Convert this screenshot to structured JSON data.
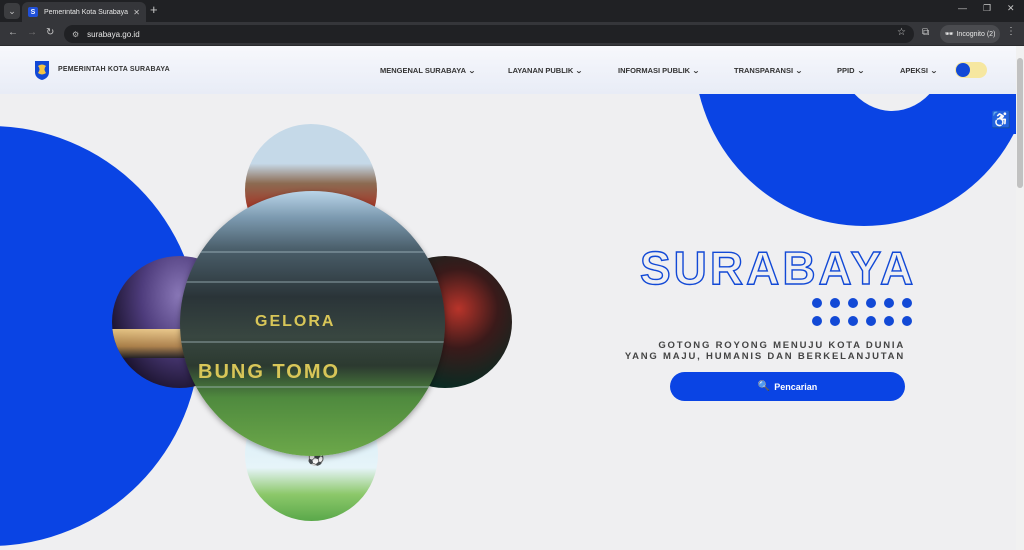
{
  "browser": {
    "tab_title": "Pemerintah Kota Surabaya",
    "favicon_letter": "S",
    "url": "surabaya.go.id",
    "incognito_label": "Incognito (2)"
  },
  "header": {
    "brand": "PEMERINTAH KOTA SURABAYA",
    "nav": [
      {
        "label": "MENGENAL SURABAYA"
      },
      {
        "label": "LAYANAN PUBLIK"
      },
      {
        "label": "INFORMASI PUBLIK"
      },
      {
        "label": "TRANSPARANSI"
      },
      {
        "label": "PPID"
      },
      {
        "label": "APEKSI"
      }
    ]
  },
  "hero": {
    "title": "SURABAYA",
    "tagline_line1": "GOTONG ROYONG MENUJU KOTA DUNIA",
    "tagline_line2": "YANG MAJU, HUMANIS DAN BERKELANJUTAN",
    "search_label": "Pencarian",
    "stadium_text_top": "GELORA",
    "stadium_text_bottom": "BUNG TOMO"
  },
  "colors": {
    "brand_blue": "#0a44e4",
    "accent_yellow": "#f5c542",
    "toggle_bg": "#f6e7a0"
  },
  "icons": [
    "search-icon",
    "accessibility-icon",
    "chevron-down-icon",
    "star-icon",
    "incognito-icon"
  ]
}
